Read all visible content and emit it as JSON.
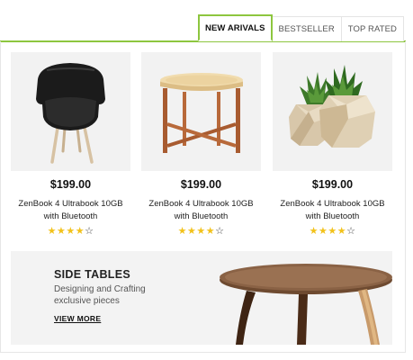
{
  "tabs": [
    {
      "label": "NEW ARIVALS",
      "active": true
    },
    {
      "label": "BESTSELLER",
      "active": false
    },
    {
      "label": "TOP RATED",
      "active": false
    }
  ],
  "products": [
    {
      "image": "armchair-image",
      "price": "$199.00",
      "name_line1": "ZenBook 4 Ultrabook 10GB",
      "name_line2": "with Bluetooth",
      "rating": 4,
      "max_rating": 5
    },
    {
      "image": "side-table-image",
      "price": "$199.00",
      "name_line1": "ZenBook 4 Ultrabook 10GB",
      "name_line2": "with Bluetooth",
      "rating": 4,
      "max_rating": 5
    },
    {
      "image": "potted-plants-image",
      "price": "$199.00",
      "name_line1": "ZenBook 4 Ultrabook 10GB",
      "name_line2": "with Bluetooth",
      "rating": 4,
      "max_rating": 5
    }
  ],
  "banner": {
    "title": "SIDE TABLES",
    "subtitle_line1": "Designing and Crafting",
    "subtitle_line2": "exclusive pieces",
    "cta": "VIEW MORE",
    "image": "round-wooden-table-image"
  },
  "colors": {
    "accent": "#8dc63f",
    "star": "#f2c21b",
    "tile_background": "#f2f2f2"
  }
}
